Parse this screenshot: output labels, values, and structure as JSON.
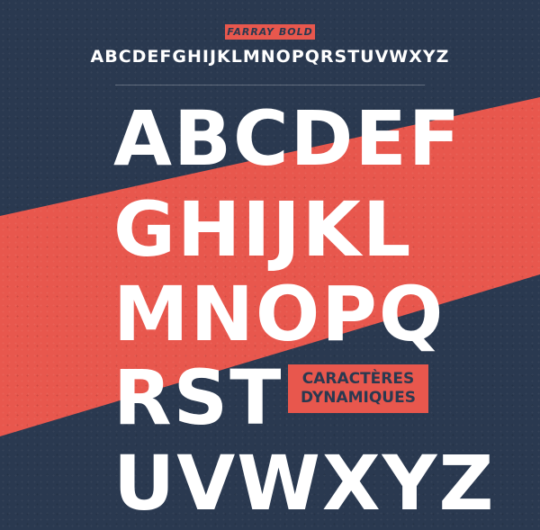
{
  "colors": {
    "background": "#2a3950",
    "accent": "#e8574d",
    "letters": "#ffffff"
  },
  "tag": "FARRAY BOLD",
  "alphabet_line": "ABCDEFGHIJKLMNOPQRSTUVWXYZ",
  "rows": [
    "ABCDEF",
    "GHIJKL",
    "MNOPQ",
    "RST",
    "UVWXYZ"
  ],
  "badge": {
    "line1": "CARACTÈRES",
    "line2": "DYNAMIQUES"
  }
}
